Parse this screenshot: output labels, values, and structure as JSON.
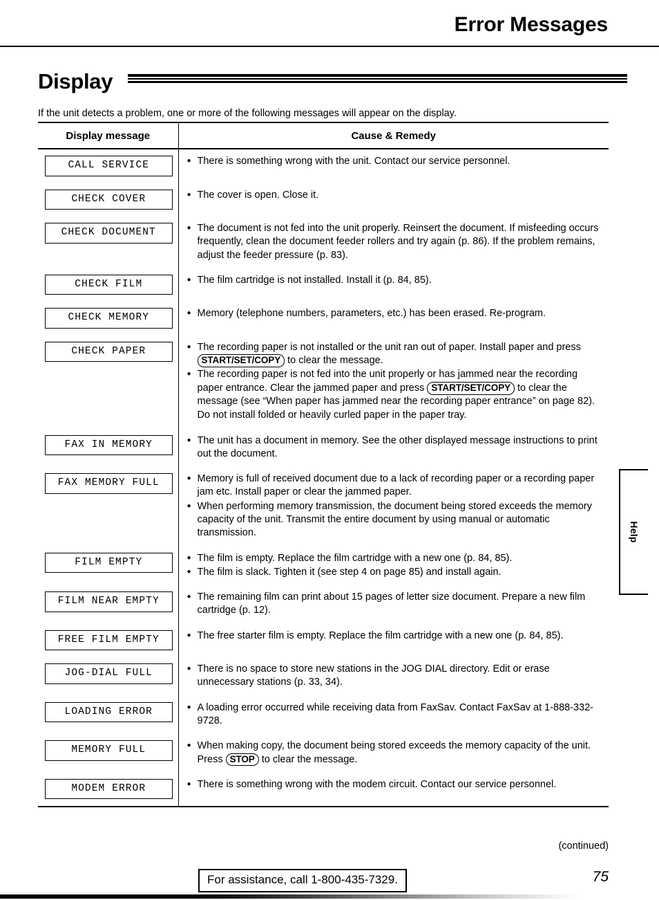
{
  "header": {
    "title": "Error Messages"
  },
  "section": {
    "heading": "Display",
    "intro": "If the unit detects a problem, one or more of the following messages will appear on the display."
  },
  "table": {
    "columns": {
      "display_message": "Display message",
      "cause_remedy": "Cause & Remedy"
    },
    "rows": [
      {
        "message": "CALL SERVICE",
        "causes": [
          {
            "bullet": true,
            "parts": [
              {
                "t": "text",
                "v": "There is something wrong with the unit. Contact our service personnel."
              }
            ]
          }
        ]
      },
      {
        "message": "CHECK COVER",
        "causes": [
          {
            "bullet": true,
            "parts": [
              {
                "t": "text",
                "v": "The cover is open. Close it."
              }
            ]
          }
        ]
      },
      {
        "message": "CHECK DOCUMENT",
        "causes": [
          {
            "bullet": true,
            "parts": [
              {
                "t": "text",
                "v": "The document is not fed into the unit properly. Reinsert the document. If misfeeding occurs frequently, clean the document feeder rollers and try again (p. 86). If the problem remains, adjust the feeder pressure (p. 83)."
              }
            ]
          }
        ]
      },
      {
        "message": "CHECK FILM",
        "causes": [
          {
            "bullet": true,
            "parts": [
              {
                "t": "text",
                "v": "The film cartridge is not installed. Install it (p. 84, 85)."
              }
            ]
          }
        ]
      },
      {
        "message": "CHECK MEMORY",
        "causes": [
          {
            "bullet": true,
            "parts": [
              {
                "t": "text",
                "v": "Memory (telephone numbers, parameters, etc.) has been erased. Re-program."
              }
            ]
          }
        ]
      },
      {
        "message": "CHECK PAPER",
        "causes": [
          {
            "bullet": true,
            "parts": [
              {
                "t": "text",
                "v": "The recording paper is not installed or the unit ran out of paper. Install paper and press "
              },
              {
                "t": "key",
                "v": "START/SET/COPY"
              },
              {
                "t": "text",
                "v": " to clear the message."
              }
            ]
          },
          {
            "bullet": true,
            "parts": [
              {
                "t": "text",
                "v": "The recording paper is not fed into the unit properly or has jammed near the recording paper entrance. Clear the jammed paper and press "
              },
              {
                "t": "key",
                "v": "START/SET/COPY"
              },
              {
                "t": "text",
                "v": " to clear the message (see “When paper has jammed near the recording paper entrance” on page 82)."
              }
            ]
          },
          {
            "bullet": false,
            "parts": [
              {
                "t": "text",
                "v": "Do not install folded or heavily curled paper in the paper tray."
              }
            ]
          }
        ]
      },
      {
        "message": "FAX IN MEMORY",
        "causes": [
          {
            "bullet": true,
            "parts": [
              {
                "t": "text",
                "v": "The unit has a document in memory. See the other displayed message instructions to print out the document."
              }
            ]
          }
        ]
      },
      {
        "message": "FAX MEMORY FULL",
        "causes": [
          {
            "bullet": true,
            "parts": [
              {
                "t": "text",
                "v": "Memory is full of received document due to a lack of recording paper or a recording paper jam etc. Install paper or clear the jammed paper."
              }
            ]
          },
          {
            "bullet": true,
            "parts": [
              {
                "t": "text",
                "v": "When performing memory transmission, the document being stored exceeds the memory capacity of the unit. Transmit the entire document by using manual or automatic transmission."
              }
            ]
          }
        ]
      },
      {
        "message": "FILM EMPTY",
        "causes": [
          {
            "bullet": true,
            "parts": [
              {
                "t": "text",
                "v": "The film is empty. Replace the film cartridge with a new one (p. 84, 85)."
              }
            ]
          },
          {
            "bullet": true,
            "parts": [
              {
                "t": "text",
                "v": "The film is slack. Tighten it (see step 4 on page 85) and install again."
              }
            ]
          }
        ]
      },
      {
        "message": "FILM NEAR EMPTY",
        "causes": [
          {
            "bullet": true,
            "parts": [
              {
                "t": "text",
                "v": "The remaining film can print about 15 pages of letter size document. Prepare a new film cartridge (p. 12)."
              }
            ]
          }
        ]
      },
      {
        "message": "FREE FILM EMPTY",
        "causes": [
          {
            "bullet": true,
            "parts": [
              {
                "t": "text",
                "v": "The free starter film is empty. Replace the film cartridge with a new one (p. 84, 85)."
              }
            ]
          }
        ]
      },
      {
        "message": "JOG-DIAL FULL",
        "causes": [
          {
            "bullet": true,
            "parts": [
              {
                "t": "text",
                "v": "There is no space to store new stations in the JOG DIAL directory. Edit or erase unnecessary stations (p. 33, 34)."
              }
            ]
          }
        ]
      },
      {
        "message": "LOADING ERROR",
        "causes": [
          {
            "bullet": true,
            "parts": [
              {
                "t": "text",
                "v": "A loading error occurred while receiving data from FaxSav. Contact FaxSav at 1-888-332-9728."
              }
            ]
          }
        ]
      },
      {
        "message": "MEMORY FULL",
        "causes": [
          {
            "bullet": true,
            "parts": [
              {
                "t": "text",
                "v": "When making copy, the document being stored exceeds the memory capacity of the unit. Press "
              },
              {
                "t": "key",
                "v": "STOP"
              },
              {
                "t": "text",
                "v": " to clear the message."
              }
            ]
          }
        ]
      },
      {
        "message": "MODEM ERROR",
        "causes": [
          {
            "bullet": true,
            "parts": [
              {
                "t": "text",
                "v": "There is something wrong with the modem circuit. Contact our service personnel."
              }
            ]
          }
        ]
      }
    ]
  },
  "side_tab": {
    "label": "Help"
  },
  "footer": {
    "continued": "(continued)",
    "assistance": "For assistance, call 1-800-435-7329.",
    "page_number": "75"
  }
}
